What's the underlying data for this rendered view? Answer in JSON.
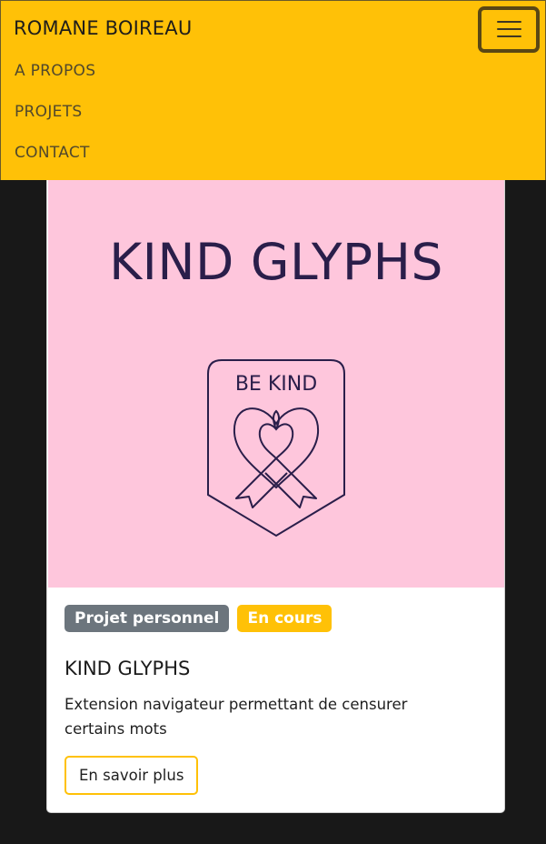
{
  "navbar": {
    "brand": "ROMANE BOIREAU",
    "toggler_icon": "hamburger-menu-icon",
    "links": [
      "A PROPOS",
      "PROJETS",
      "CONTACT"
    ],
    "background_color": "#ffc107"
  },
  "project_card": {
    "image": {
      "title": "KIND GLYPHS",
      "logo_text": "BE KIND",
      "logo_icon": "awareness-ribbon-heart-icon",
      "background_color": "#fec6dc"
    },
    "badges": [
      "Projet personnel",
      "En cours"
    ],
    "title": "KIND GLYPHS",
    "description": "Extension navigateur permettant de censurer certains mots",
    "button_label": "En savoir plus"
  }
}
